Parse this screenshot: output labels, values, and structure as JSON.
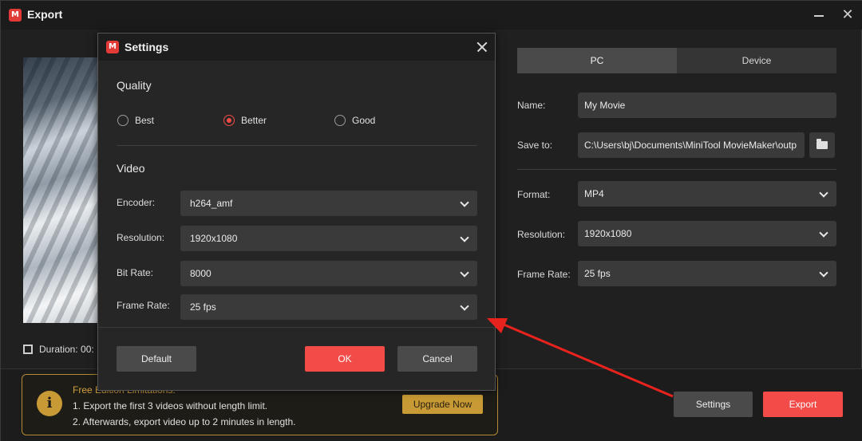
{
  "window": {
    "title": "Export",
    "logo_text": "M"
  },
  "preview": {
    "duration_label": "Duration:",
    "duration_value": "00:"
  },
  "tabs": [
    {
      "label": "PC",
      "active": true
    },
    {
      "label": "Device",
      "active": false
    }
  ],
  "right_panel": {
    "name_label": "Name:",
    "name_value": "My Movie",
    "save_label": "Save to:",
    "save_value": "C:\\Users\\bj\\Documents\\MiniTool MovieMaker\\outp",
    "format_label": "Format:",
    "format_value": "MP4",
    "resolution_label": "Resolution:",
    "resolution_value": "1920x1080",
    "framerate_label": "Frame Rate:",
    "framerate_value": "25 fps"
  },
  "notice": {
    "title": "Free Edition Limitations:",
    "line1": "1. Export the first 3 videos without length limit.",
    "line2": "2. Afterwards, export video up to 2 minutes in length.",
    "upgrade_label": "Upgrade Now"
  },
  "footer": {
    "settings_label": "Settings",
    "export_label": "Export"
  },
  "dialog": {
    "title": "Settings",
    "quality_heading": "Quality",
    "quality_options": [
      {
        "label": "Best",
        "checked": false
      },
      {
        "label": "Better",
        "checked": true
      },
      {
        "label": "Good",
        "checked": false
      }
    ],
    "video_heading": "Video",
    "encoder_label": "Encoder:",
    "encoder_value": "h264_amf",
    "resolution_label": "Resolution:",
    "resolution_value": "1920x1080",
    "bitrate_label": "Bit Rate:",
    "bitrate_value": "8000",
    "framerate_label": "Frame Rate:",
    "framerate_value": "25 fps",
    "default_label": "Default",
    "ok_label": "OK",
    "cancel_label": "Cancel"
  },
  "colors": {
    "accent_red": "#f24b48",
    "annotation_arrow": "#e8231d",
    "notice_gold": "#c89a35"
  }
}
